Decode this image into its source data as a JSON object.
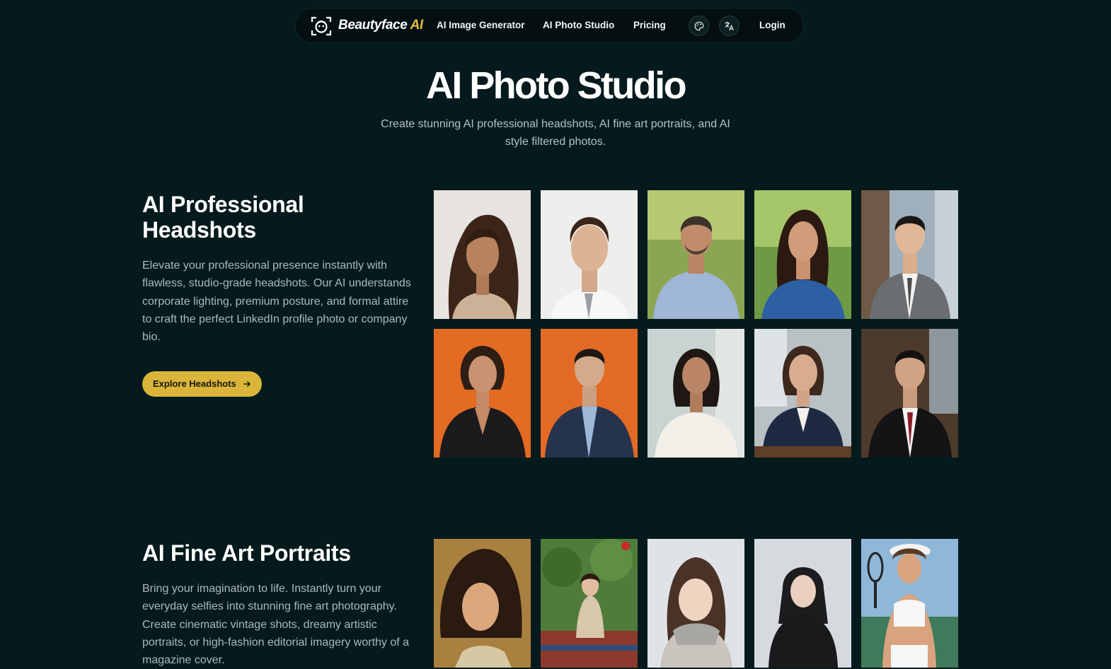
{
  "nav": {
    "brand_name": "Beautyface",
    "brand_accent": "AI",
    "links": [
      "AI Image Generator",
      "AI Photo Studio",
      "Pricing"
    ],
    "login_label": "Login",
    "icons": [
      "palette-icon",
      "translate-icon"
    ]
  },
  "hero": {
    "title": "AI Photo Studio",
    "subtitle": "Create stunning AI professional headshots, AI fine art portraits, and AI style filtered photos."
  },
  "sections": [
    {
      "title": "AI Professional Headshots",
      "description": "Elevate your professional presence instantly with flawless, studio-grade headshots. Our AI understands corporate lighting, premium posture, and formal attire to craft the perfect LinkedIn profile photo or company bio.",
      "cta_label": "Explore Headshots",
      "images": [
        "headshot-woman-beige-sweater",
        "headshot-man-white-shirt-tie",
        "headshot-man-blue-shirt-park",
        "headshot-woman-blue-shirt-park",
        "headshot-man-grey-suit-office",
        "headshot-woman-black-blazer-orange",
        "headshot-man-navy-suit-orange",
        "headshot-woman-white-blouse-office",
        "headshot-woman-navy-blazer-desk",
        "headshot-man-black-suit-red-tie"
      ]
    },
    {
      "title": "AI Fine Art Portraits",
      "description": "Bring your imagination to life. Instantly turn your everyday selfies into stunning fine art photography. Create cinematic vintage shots, dreamy artistic portraits, or high-fashion editorial imagery worthy of a magazine cover.",
      "images": [
        "portrait-golden-vintage",
        "portrait-plants-rug",
        "portrait-snow-scarf",
        "portrait-winter-coat-hood",
        "portrait-tennis-player"
      ]
    }
  ],
  "colors": {
    "background": "#051a1c",
    "navbar": "#030f11",
    "accent": "#e3bb3c",
    "button": "#dbb53b",
    "muted_text": "#aeb9bb"
  }
}
